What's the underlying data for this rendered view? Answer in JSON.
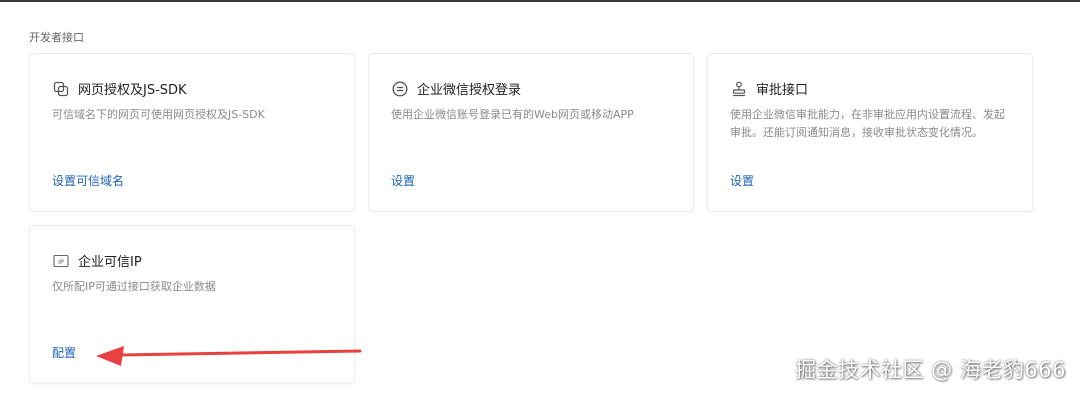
{
  "section": {
    "title": "开发者接口"
  },
  "cards": [
    {
      "title": "网页授权及JS-SDK",
      "icon": "web-auth-icon",
      "description": "可信域名下的网页可使用网页授权及JS-SDK",
      "link": "设置可信域名"
    },
    {
      "title": "企业微信授权登录",
      "icon": "login-icon",
      "description": "使用企业微信账号登录已有的Web网页或移动APP",
      "link": "设置"
    },
    {
      "title": "审批接口",
      "icon": "stamp-icon",
      "description": "使用企业微信审批能力，在非审批应用内设置流程、发起审批。还能订阅通知消息，接收审批状态变化情况。",
      "link": "设置"
    },
    {
      "title": "企业可信IP",
      "icon": "ip-icon",
      "description": "仅所配IP可通过接口获取企业数据",
      "link": "配置"
    }
  ],
  "annotation": {
    "arrow_color": "#e8413f"
  },
  "watermark": {
    "text": "掘金技术社区 @ 海老豹666"
  },
  "colors": {
    "link": "#1d63b8",
    "accent_arrow": "#e8413f"
  }
}
